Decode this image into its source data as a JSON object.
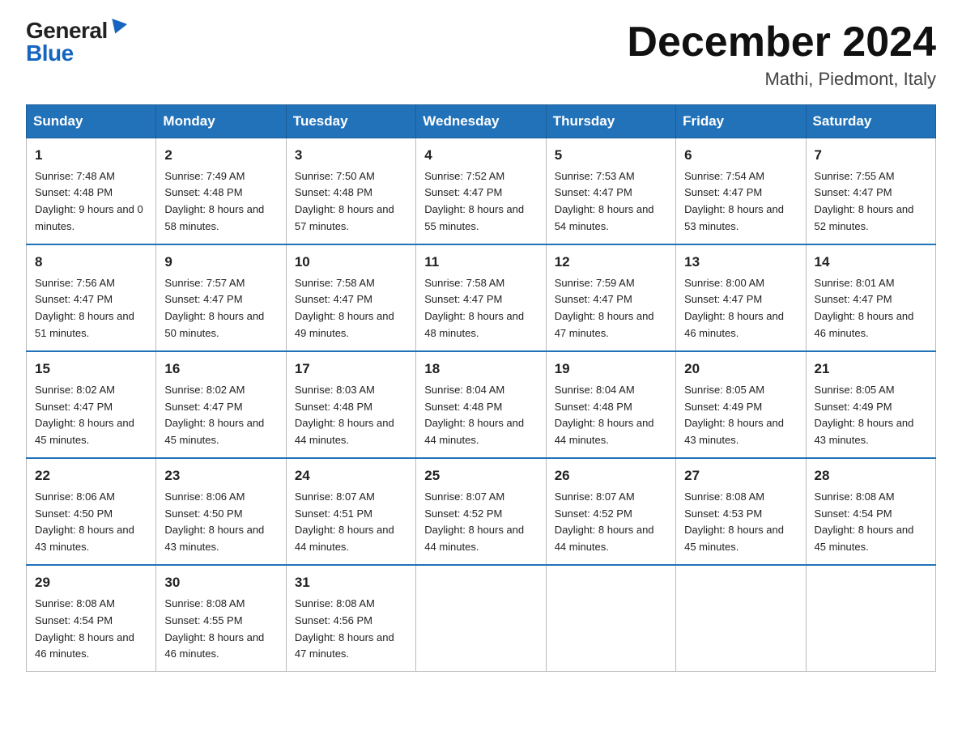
{
  "logo": {
    "general": "General",
    "blue": "Blue"
  },
  "title": "December 2024",
  "location": "Mathi, Piedmont, Italy",
  "days_of_week": [
    "Sunday",
    "Monday",
    "Tuesday",
    "Wednesday",
    "Thursday",
    "Friday",
    "Saturday"
  ],
  "weeks": [
    [
      {
        "day": 1,
        "sunrise": "7:48 AM",
        "sunset": "4:48 PM",
        "daylight": "9 hours and 0 minutes."
      },
      {
        "day": 2,
        "sunrise": "7:49 AM",
        "sunset": "4:48 PM",
        "daylight": "8 hours and 58 minutes."
      },
      {
        "day": 3,
        "sunrise": "7:50 AM",
        "sunset": "4:48 PM",
        "daylight": "8 hours and 57 minutes."
      },
      {
        "day": 4,
        "sunrise": "7:52 AM",
        "sunset": "4:47 PM",
        "daylight": "8 hours and 55 minutes."
      },
      {
        "day": 5,
        "sunrise": "7:53 AM",
        "sunset": "4:47 PM",
        "daylight": "8 hours and 54 minutes."
      },
      {
        "day": 6,
        "sunrise": "7:54 AM",
        "sunset": "4:47 PM",
        "daylight": "8 hours and 53 minutes."
      },
      {
        "day": 7,
        "sunrise": "7:55 AM",
        "sunset": "4:47 PM",
        "daylight": "8 hours and 52 minutes."
      }
    ],
    [
      {
        "day": 8,
        "sunrise": "7:56 AM",
        "sunset": "4:47 PM",
        "daylight": "8 hours and 51 minutes."
      },
      {
        "day": 9,
        "sunrise": "7:57 AM",
        "sunset": "4:47 PM",
        "daylight": "8 hours and 50 minutes."
      },
      {
        "day": 10,
        "sunrise": "7:58 AM",
        "sunset": "4:47 PM",
        "daylight": "8 hours and 49 minutes."
      },
      {
        "day": 11,
        "sunrise": "7:58 AM",
        "sunset": "4:47 PM",
        "daylight": "8 hours and 48 minutes."
      },
      {
        "day": 12,
        "sunrise": "7:59 AM",
        "sunset": "4:47 PM",
        "daylight": "8 hours and 47 minutes."
      },
      {
        "day": 13,
        "sunrise": "8:00 AM",
        "sunset": "4:47 PM",
        "daylight": "8 hours and 46 minutes."
      },
      {
        "day": 14,
        "sunrise": "8:01 AM",
        "sunset": "4:47 PM",
        "daylight": "8 hours and 46 minutes."
      }
    ],
    [
      {
        "day": 15,
        "sunrise": "8:02 AM",
        "sunset": "4:47 PM",
        "daylight": "8 hours and 45 minutes."
      },
      {
        "day": 16,
        "sunrise": "8:02 AM",
        "sunset": "4:47 PM",
        "daylight": "8 hours and 45 minutes."
      },
      {
        "day": 17,
        "sunrise": "8:03 AM",
        "sunset": "4:48 PM",
        "daylight": "8 hours and 44 minutes."
      },
      {
        "day": 18,
        "sunrise": "8:04 AM",
        "sunset": "4:48 PM",
        "daylight": "8 hours and 44 minutes."
      },
      {
        "day": 19,
        "sunrise": "8:04 AM",
        "sunset": "4:48 PM",
        "daylight": "8 hours and 44 minutes."
      },
      {
        "day": 20,
        "sunrise": "8:05 AM",
        "sunset": "4:49 PM",
        "daylight": "8 hours and 43 minutes."
      },
      {
        "day": 21,
        "sunrise": "8:05 AM",
        "sunset": "4:49 PM",
        "daylight": "8 hours and 43 minutes."
      }
    ],
    [
      {
        "day": 22,
        "sunrise": "8:06 AM",
        "sunset": "4:50 PM",
        "daylight": "8 hours and 43 minutes."
      },
      {
        "day": 23,
        "sunrise": "8:06 AM",
        "sunset": "4:50 PM",
        "daylight": "8 hours and 43 minutes."
      },
      {
        "day": 24,
        "sunrise": "8:07 AM",
        "sunset": "4:51 PM",
        "daylight": "8 hours and 44 minutes."
      },
      {
        "day": 25,
        "sunrise": "8:07 AM",
        "sunset": "4:52 PM",
        "daylight": "8 hours and 44 minutes."
      },
      {
        "day": 26,
        "sunrise": "8:07 AM",
        "sunset": "4:52 PM",
        "daylight": "8 hours and 44 minutes."
      },
      {
        "day": 27,
        "sunrise": "8:08 AM",
        "sunset": "4:53 PM",
        "daylight": "8 hours and 45 minutes."
      },
      {
        "day": 28,
        "sunrise": "8:08 AM",
        "sunset": "4:54 PM",
        "daylight": "8 hours and 45 minutes."
      }
    ],
    [
      {
        "day": 29,
        "sunrise": "8:08 AM",
        "sunset": "4:54 PM",
        "daylight": "8 hours and 46 minutes."
      },
      {
        "day": 30,
        "sunrise": "8:08 AM",
        "sunset": "4:55 PM",
        "daylight": "8 hours and 46 minutes."
      },
      {
        "day": 31,
        "sunrise": "8:08 AM",
        "sunset": "4:56 PM",
        "daylight": "8 hours and 47 minutes."
      },
      null,
      null,
      null,
      null
    ]
  ]
}
